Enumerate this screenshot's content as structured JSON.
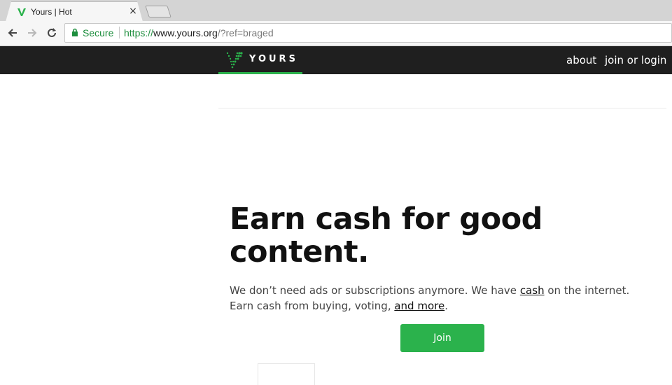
{
  "browser": {
    "tab": {
      "title": "Yours | Hot",
      "close_glyph": "×"
    },
    "omnibox": {
      "secure_label": "Secure",
      "url_scheme": "https://",
      "url_host": "www.yours.org",
      "url_rest": "/?ref=braged"
    },
    "icons": {
      "back": "back-arrow-icon",
      "forward": "forward-arrow-icon",
      "reload": "reload-icon",
      "lock": "lock-icon",
      "favicon": "yours-logo-icon"
    }
  },
  "site": {
    "logo_text": "YOURS",
    "nav": {
      "about": "about",
      "join_or_login": "join or login"
    }
  },
  "hero": {
    "title": "Earn cash for good content.",
    "subtitle_part1": "We don’t need ads or subscriptions anymore. We have ",
    "subtitle_link_cash": "cash",
    "subtitle_part2": " on the internet. Earn cash from buying, voting, ",
    "subtitle_link_more": "and more",
    "subtitle_part3": ".",
    "join_label": "Join"
  },
  "colors": {
    "brand_green": "#2bb24c",
    "header_bg": "#1f1f1f",
    "secure_green": "#1e8e3e"
  }
}
